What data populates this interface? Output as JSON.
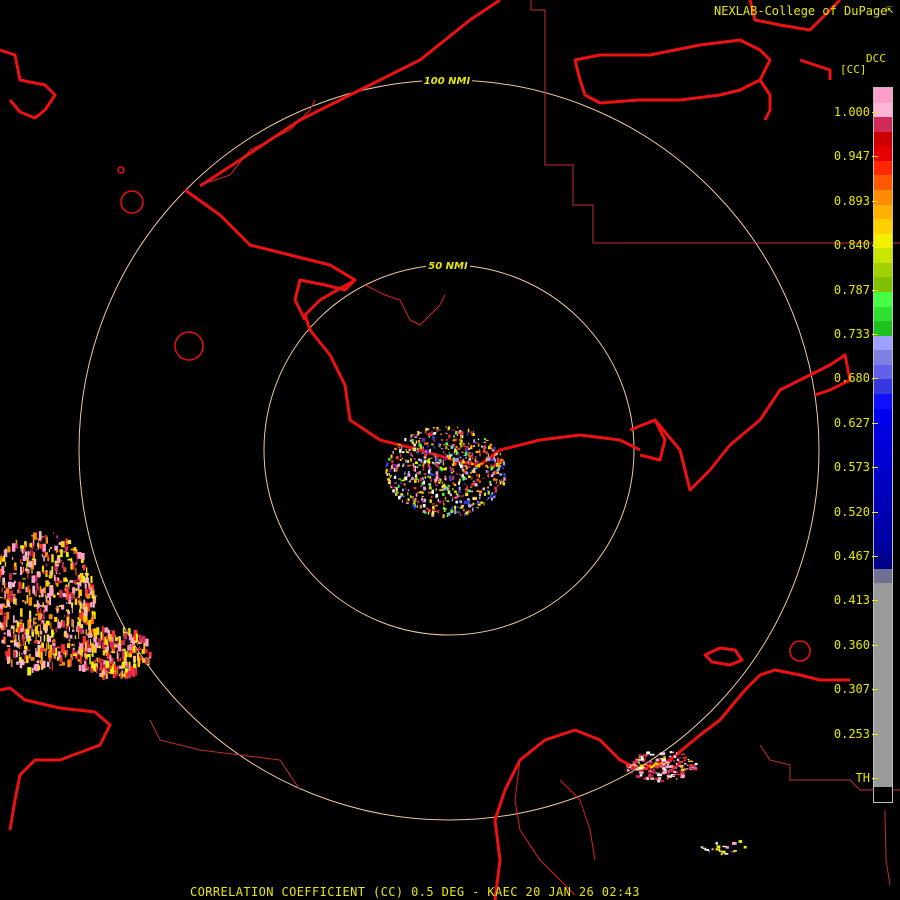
{
  "credit": "NEXLAB-College of DuPage",
  "credit_icon": "corner-arrow-icon",
  "product_code": "DCC",
  "unit": "[CC]",
  "footer": "CORRELATION COEFFICIENT (CC) 0.5 DEG - KAEC 20 JAN 26 02:43",
  "range_rings": [
    {
      "label": "50 NMI"
    },
    {
      "label": "100 NMI"
    }
  ],
  "scale": {
    "ticks": [
      "1.000",
      "0.947",
      "0.893",
      "0.840",
      "0.787",
      "0.733",
      "0.680",
      "0.627",
      "0.573",
      "0.520",
      "0.467",
      "0.413",
      "0.360",
      "0.307",
      "0.253",
      "TH"
    ],
    "colors": [
      "#ff9ec8",
      "#ffb6d5",
      "#d02a5a",
      "#cc0000",
      "#e60000",
      "#ff2800",
      "#ff5a00",
      "#ff8c00",
      "#ffb000",
      "#ffd000",
      "#f0f000",
      "#c8e600",
      "#a0d000",
      "#80c000",
      "#44ff44",
      "#30e030",
      "#20c020",
      "#9ea0ff",
      "#8080e0",
      "#6060e8",
      "#3838e0",
      "#1010ff",
      "#0000f0",
      "#0000e0",
      "#0000d8",
      "#0000d0",
      "#0000c8",
      "#0000c0",
      "#0000b8",
      "#0000b0",
      "#0000a8",
      "#00009c",
      "#00008c",
      "#707090",
      "#9a9a9a",
      "#9a9a9a",
      "#9a9a9a",
      "#9a9a9a",
      "#9a9a9a",
      "#9a9a9a",
      "#9a9a9a",
      "#9a9a9a",
      "#9a9a9a",
      "#9a9a9a",
      "#9a9a9a",
      "#9a9a9a",
      "#9a9a9a",
      "#9a9a9a",
      "#000000"
    ]
  },
  "colors": {
    "coast": "#ee1111",
    "border": "#c03030",
    "ring": "#f0c8a0",
    "label": "#e8e800"
  }
}
